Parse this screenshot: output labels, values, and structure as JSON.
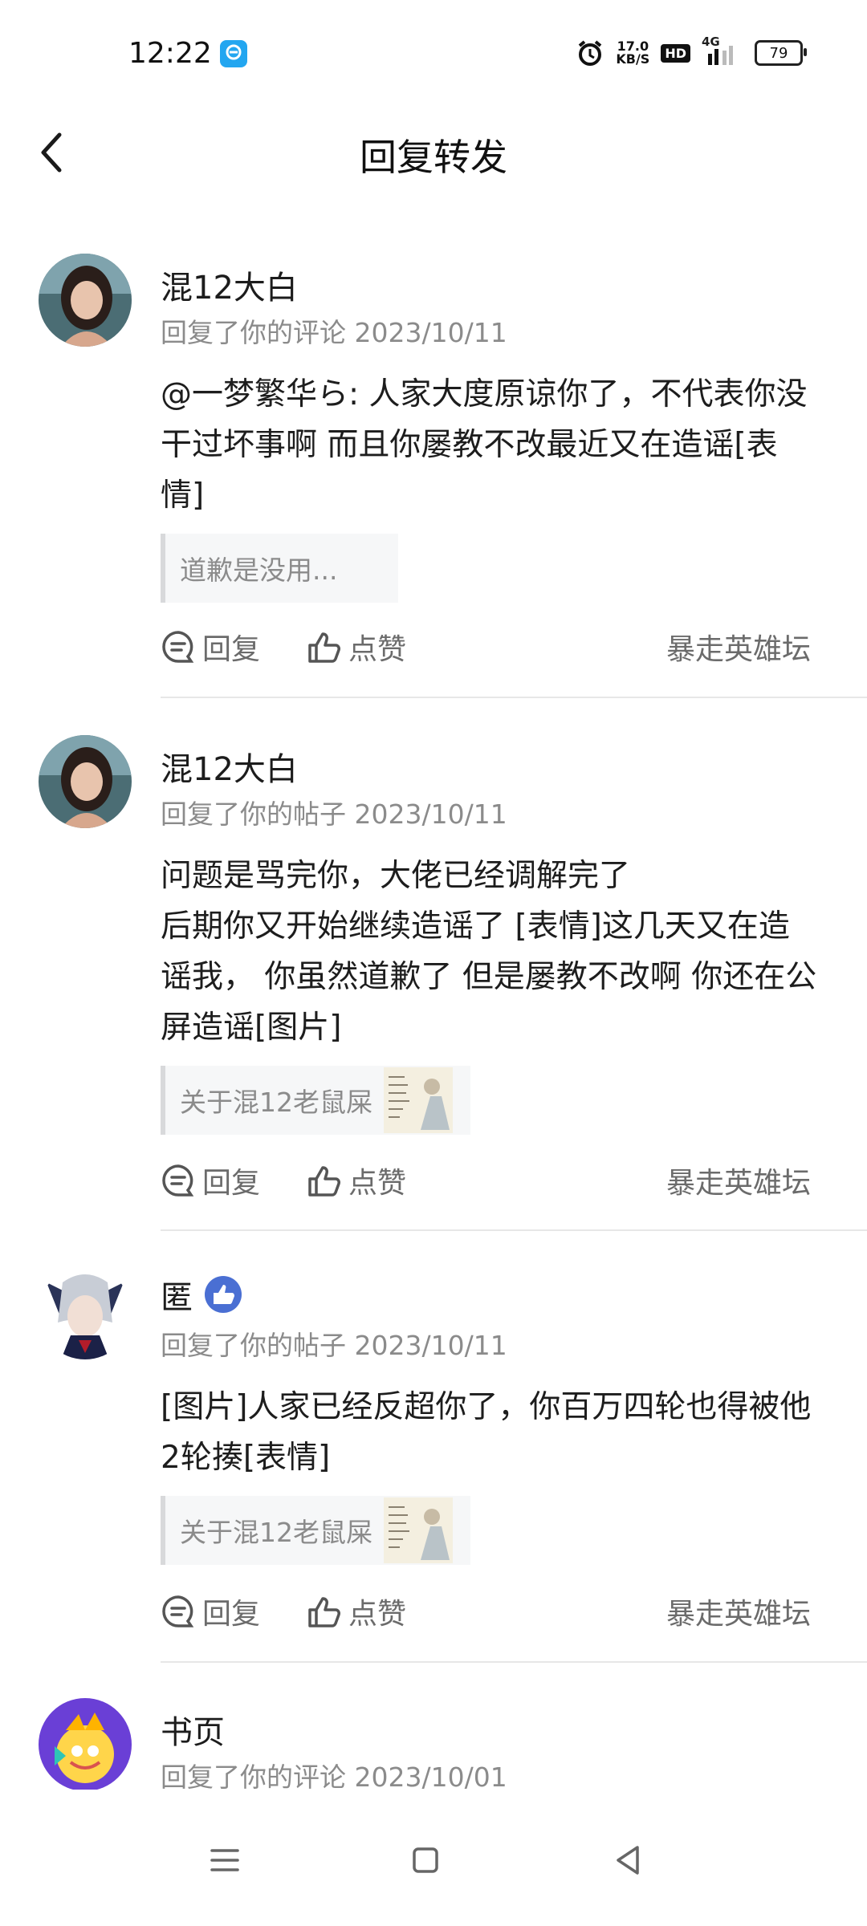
{
  "status_bar": {
    "time": "12:22",
    "network_speed": "17.0",
    "network_unit": "KB/S",
    "hd_label": "HD",
    "signal_label": "4G",
    "battery": "79"
  },
  "header": {
    "title": "回复转发"
  },
  "items": [
    {
      "name": "混12大白",
      "meta": "回复了你的评论 2023/10/11",
      "content": "@一梦繁华ら: 人家大度原谅你了，不代表你没干过坏事啊 而且你屡教不改最近又在造谣[表情]",
      "quote": "道歉是没用...",
      "reply_label": "回复",
      "like_label": "点赞",
      "forum": "暴走英雄坛"
    },
    {
      "name": "混12大白",
      "meta": "回复了你的帖子 2023/10/11",
      "content": "问题是骂完你，大佬已经调解完了\n后期你又开始继续造谣了 [表情]这几天又在造谣我， 你虽然道歉了 但是屡教不改啊 你还在公屏造谣[图片]",
      "quote": "关于混12老鼠屎",
      "reply_label": "回复",
      "like_label": "点赞",
      "forum": "暴走英雄坛"
    },
    {
      "name": "匿",
      "meta": "回复了你的帖子 2023/10/11",
      "content": "[图片]人家已经反超你了，你百万四轮也得被他2轮揍[表情]",
      "quote": "关于混12老鼠屎",
      "reply_label": "回复",
      "like_label": "点赞",
      "forum": "暴走英雄坛"
    },
    {
      "name": "书页",
      "meta": "回复了你的评论 2023/10/01"
    }
  ],
  "icons": {
    "reply": "comment-icon",
    "like": "thumbs-up-icon",
    "badge": "thumbs-up-badge-icon",
    "nav": [
      "menu-icon",
      "home-square-icon",
      "back-triangle-icon"
    ]
  },
  "colors": {
    "text_primary": "#1d1d1d",
    "text_secondary": "#8b8b8b",
    "accent_blue": "#4a6fd3"
  }
}
